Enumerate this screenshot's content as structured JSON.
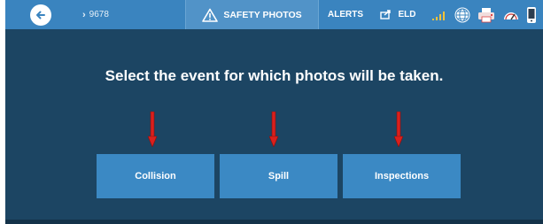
{
  "topbar": {
    "vehicle_id": "9678",
    "title": "SAFETY PHOTOS",
    "alerts_label": "ALERTS",
    "eld_label": "ELD",
    "icons": [
      "back-arrow-icon",
      "warning-icon",
      "share-icon",
      "signal-icon",
      "globe-icon",
      "printer-icon",
      "gauge-icon",
      "phone-icon"
    ]
  },
  "main": {
    "prompt": "Select the event for which photos will be taken.",
    "events": [
      {
        "label": "Collision"
      },
      {
        "label": "Spill"
      },
      {
        "label": "Inspections"
      }
    ]
  },
  "colors": {
    "background": "#1c4563",
    "topbar": "#3a84bf",
    "button": "#3b89c4",
    "arrow": "#d9201d"
  }
}
